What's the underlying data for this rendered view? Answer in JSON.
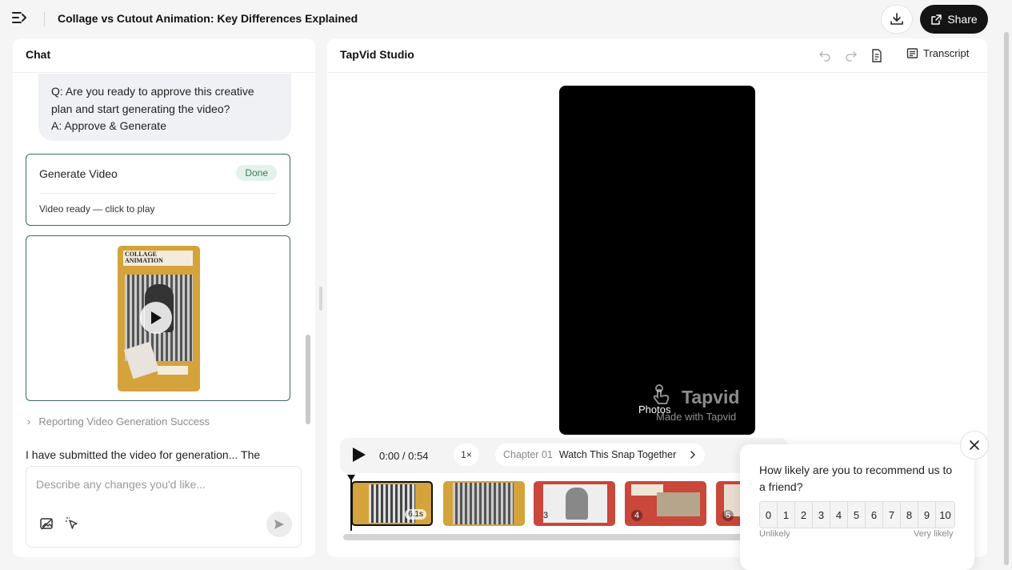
{
  "header": {
    "title": "Collage vs Cutout Animation: Key Differences Explained",
    "share_label": "Share"
  },
  "chat": {
    "title": "Chat",
    "qa": {
      "question": "Q: Are you ready to approve this creative plan and start generating the video?",
      "answer": "A: Approve & Generate"
    },
    "generate_card": {
      "title": "Generate Video",
      "badge": "Done",
      "status": "Video ready — click to play"
    },
    "thumbnail_banner": "COLLAGE ANIMATION",
    "step": "Reporting Video Generation Success",
    "message": "I have submitted the video for generation... The",
    "input": {
      "placeholder": "Describe any changes you'd like..."
    }
  },
  "studio": {
    "title": "TapVid Studio",
    "transcript_label": "Transcript",
    "video": {
      "overlay_text": "Photos",
      "watermark_brand": "Tapvid",
      "watermark_caption": "Made with Tapvid"
    },
    "controls": {
      "time": "0:00 / 0:54",
      "speed": "1×",
      "chapter_number": "Chapter 01",
      "chapter_title": "Watch This Snap Together"
    },
    "clips": [
      {
        "label": "",
        "duration": "6.1s",
        "active": true
      },
      {
        "label": "",
        "duration": "",
        "active": false
      },
      {
        "label": "3",
        "duration": "",
        "active": false
      },
      {
        "label": "4",
        "duration": "",
        "active": false
      },
      {
        "label": "5",
        "duration": "",
        "active": false
      }
    ]
  },
  "survey": {
    "question": "How likely are you to recommend us to a friend?",
    "scores": [
      "0",
      "1",
      "2",
      "3",
      "4",
      "5",
      "6",
      "7",
      "8",
      "9",
      "10"
    ],
    "low_label": "Unlikely",
    "high_label": "Very likely"
  },
  "colors": {
    "accent_dark": "#141414",
    "card_border": "#3d6864",
    "done_bg": "#e3f2eb",
    "done_text": "#3d7a5c",
    "clip_gold": "#d4a33c",
    "clip_red": "#c9473b"
  }
}
